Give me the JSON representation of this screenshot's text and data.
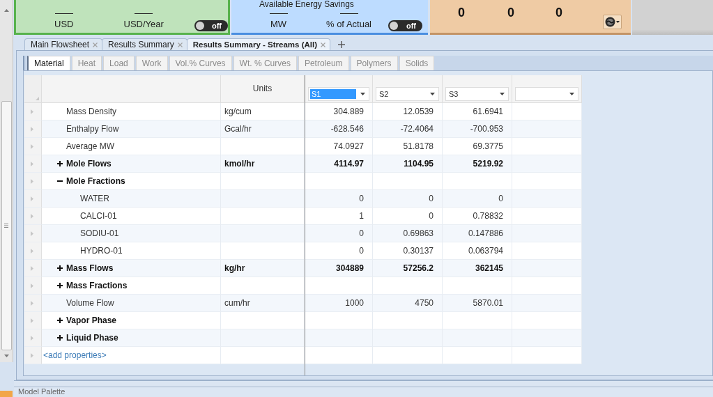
{
  "top_panels": [
    {
      "kind": "cost",
      "fields": [
        {
          "label": "USD"
        },
        {
          "label": "USD/Year"
        }
      ],
      "toggle": {
        "label": "off",
        "on": false
      }
    },
    {
      "kind": "energy",
      "title": "Available Energy Savings",
      "fields": [
        {
          "label": "MW"
        },
        {
          "label": "% of Actual"
        }
      ],
      "toggle": {
        "label": "off",
        "on": false
      }
    },
    {
      "kind": "counts",
      "values": [
        "0",
        "0",
        "0"
      ]
    }
  ],
  "document_tabs": [
    {
      "label": "Main Flowsheet",
      "selected": false
    },
    {
      "label": "Results Summary",
      "selected": false
    },
    {
      "label": "Results Summary - Streams (All)",
      "selected": true
    }
  ],
  "sub_tabs": [
    {
      "label": "Material",
      "selected": true
    },
    {
      "label": "Heat",
      "selected": false
    },
    {
      "label": "Load",
      "selected": false
    },
    {
      "label": "Work",
      "selected": false
    },
    {
      "label": "Vol.% Curves",
      "selected": false
    },
    {
      "label": "Wt. % Curves",
      "selected": false
    },
    {
      "label": "Petroleum",
      "selected": false
    },
    {
      "label": "Polymers",
      "selected": false
    },
    {
      "label": "Solids",
      "selected": false
    }
  ],
  "table": {
    "units_header": "Units",
    "streams": [
      {
        "value": "S1",
        "selected": true
      },
      {
        "value": "S2",
        "selected": false
      },
      {
        "value": "S3",
        "selected": false
      },
      {
        "selected": false
      }
    ],
    "rows": [
      {
        "kind": "property",
        "label": "Mass Density",
        "units": "kg/cum",
        "values": [
          "304.889",
          "12.0539",
          "61.6941"
        ]
      },
      {
        "kind": "property",
        "label": "Enthalpy Flow",
        "units": "Gcal/hr",
        "values": [
          "-628.546",
          "-72.4064",
          "-700.953"
        ]
      },
      {
        "kind": "property",
        "label": "Average MW",
        "values": [
          "74.0927",
          "51.8178",
          "69.3775"
        ]
      },
      {
        "kind": "group",
        "label": "Mole Flows",
        "units": "kmol/hr",
        "expanded": false,
        "values": [
          "4114.97",
          "1104.95",
          "5219.92"
        ]
      },
      {
        "kind": "group",
        "label": "Mole Fractions",
        "expanded": true,
        "children": [
          {
            "kind": "property",
            "label": "WATER",
            "values": [
              "0",
              "0",
              "0"
            ]
          },
          {
            "kind": "property",
            "label": "CALCI-01",
            "values": [
              "1",
              "0",
              "0.78832"
            ]
          },
          {
            "kind": "property",
            "label": "SODIU-01",
            "values": [
              "0",
              "0.69863",
              "0.147886"
            ]
          },
          {
            "kind": "property",
            "label": "HYDRO-01",
            "values": [
              "0",
              "0.30137",
              "0.063794"
            ]
          }
        ]
      },
      {
        "kind": "group",
        "label": "Mass Flows",
        "units": "kg/hr",
        "expanded": false,
        "values": [
          "304889",
          "57256.2",
          "362145"
        ]
      },
      {
        "kind": "group",
        "label": "Mass Fractions",
        "expanded": false
      },
      {
        "kind": "property",
        "label": "Volume Flow",
        "units": "cum/hr",
        "values": [
          "1000",
          "4750",
          "5870.01"
        ]
      },
      {
        "kind": "group",
        "label": "Vapor Phase",
        "expanded": false
      },
      {
        "kind": "group",
        "label": "Liquid Phase",
        "expanded": false
      }
    ],
    "add_link": "<add properties>"
  },
  "bottom_panel": {
    "title": "Model Palette"
  }
}
